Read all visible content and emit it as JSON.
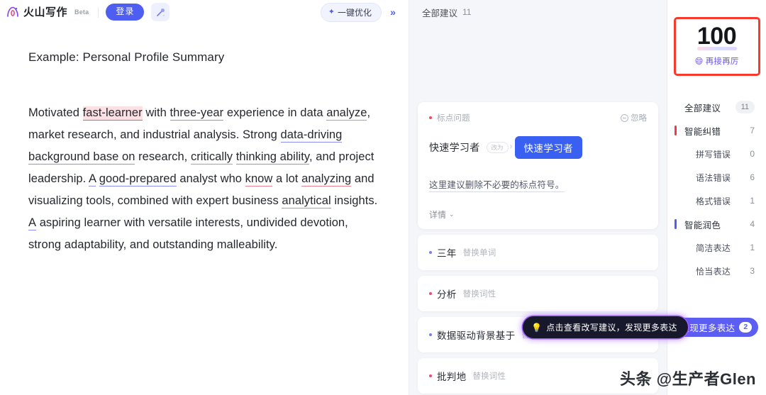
{
  "header": {
    "brand_name": "火山写作",
    "beta_label": "Beta",
    "login_label": "登录",
    "magic_icon": "magic-wand-icon",
    "optimize_label": "一键优化",
    "optimize_icon": "sparkle-icon",
    "collapse_icon": "double-chevron-right-icon"
  },
  "document": {
    "title": "Example: Personal Profile Summary",
    "paragraph_segments": [
      {
        "text": "Motivated ",
        "style": "plain"
      },
      {
        "text": "fast-learner",
        "style": "hl-pink"
      },
      {
        "text": " with ",
        "style": "plain"
      },
      {
        "text": "three-year",
        "style": "u-purple"
      },
      {
        "text": " experience in data ",
        "style": "plain"
      },
      {
        "text": "analyze",
        "style": "u-red"
      },
      {
        "text": ", market research, and industrial analysis. Strong ",
        "style": "plain"
      },
      {
        "text": "data-driving background base on",
        "style": "u-purple"
      },
      {
        "text": " research, ",
        "style": "plain"
      },
      {
        "text": "critically",
        "style": "u-red"
      },
      {
        "text": " ",
        "style": "plain"
      },
      {
        "text": "thinking ability",
        "style": "u-purple"
      },
      {
        "text": ", and project leadership. ",
        "style": "plain"
      },
      {
        "text": "A",
        "style": "u-purple"
      },
      {
        "text": " ",
        "style": "plain"
      },
      {
        "text": "good-prepared",
        "style": "u-purple"
      },
      {
        "text": " analyst who ",
        "style": "plain"
      },
      {
        "text": "know",
        "style": "u-red"
      },
      {
        "text": " a lot ",
        "style": "plain"
      },
      {
        "text": "analyzing",
        "style": "u-red"
      },
      {
        "text": " and visualizing tools, combined with expert business ",
        "style": "plain"
      },
      {
        "text": "analytical",
        "style": "u-red"
      },
      {
        "text": " insights. ",
        "style": "plain"
      },
      {
        "text": "A",
        "style": "u-purple"
      },
      {
        "text": " aspiring learner with versatile interests, undivided devotion, strong adaptability, and outstanding malleability.",
        "style": "plain"
      }
    ]
  },
  "suggestions_panel": {
    "header_label": "全部建议",
    "header_count": "11",
    "main_card": {
      "tag": "标点问题",
      "tag_dot_color": "#ef4a5c",
      "ignore_label": "忽略",
      "ignore_icon": "minus-circle-icon",
      "original_text": "快速学习者",
      "arrow_label": "改为",
      "replacement_text": "快速学习者",
      "description": "这里建议删除不必要的标点符号。",
      "detail_label": "详情",
      "detail_icon": "chevron-down-icon"
    },
    "rows": [
      {
        "word": "三年",
        "kind": "替换单词",
        "dot_color": "#7b7ef0"
      },
      {
        "word": "分析",
        "kind": "替换词性",
        "dot_color": "#ef4a7c"
      },
      {
        "word": "数据驱动背景基于",
        "kind": "替换词性",
        "dot_color": "#7b7ef0"
      },
      {
        "word": "批判地",
        "kind": "替换词性",
        "dot_color": "#ef4a7c"
      }
    ],
    "tooltip": {
      "icon": "lightbulb-icon",
      "text": "点击查看改写建议，发现更多表达"
    }
  },
  "right_sidebar": {
    "score": {
      "value": "100",
      "sub_icon": "smiling-face-icon",
      "sub_label": "再接再厉",
      "highlight_color": "#f63b2e"
    },
    "stats": [
      {
        "label": "全部建议",
        "value": "11",
        "level": "total",
        "bar_color": ""
      },
      {
        "label": "智能纠错",
        "value": "7",
        "level": "head",
        "bar_color": "#f0394f"
      },
      {
        "label": "拼写错误",
        "value": "0",
        "level": "sub",
        "bar_color": ""
      },
      {
        "label": "语法错误",
        "value": "6",
        "level": "sub",
        "bar_color": ""
      },
      {
        "label": "格式错误",
        "value": "1",
        "level": "sub",
        "bar_color": ""
      },
      {
        "label": "智能润色",
        "value": "4",
        "level": "head",
        "bar_color": "#4e5ef0"
      },
      {
        "label": "简洁表达",
        "value": "1",
        "level": "sub",
        "bar_color": ""
      },
      {
        "label": "恰当表达",
        "value": "3",
        "level": "sub",
        "bar_color": ""
      }
    ],
    "discover_button": {
      "label": "发现更多表达",
      "badge": "2",
      "color": "#5b5ef0"
    }
  },
  "watermark": "头条 @生产者Glen"
}
